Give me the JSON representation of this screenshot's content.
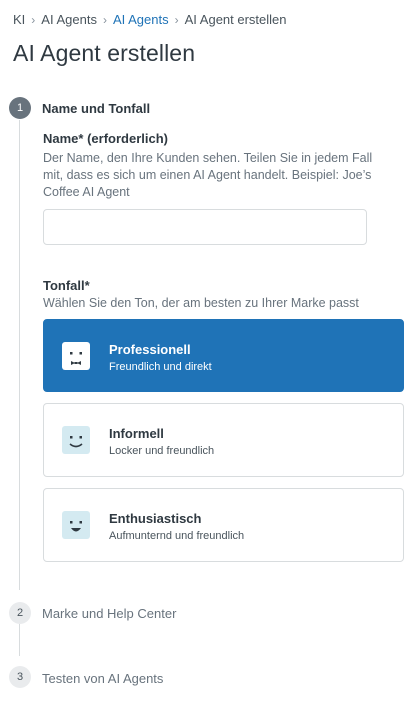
{
  "breadcrumb": {
    "items": [
      "KI",
      "AI Agents",
      "AI Agents",
      "AI Agent erstellen"
    ]
  },
  "page": {
    "title": "AI Agent erstellen"
  },
  "steps": [
    {
      "number": "1",
      "title": "Name und Tonfall",
      "state": "active"
    },
    {
      "number": "2",
      "title": "Marke und Help Center",
      "state": "inactive"
    },
    {
      "number": "3",
      "title": "Testen von AI Agents",
      "state": "inactive"
    }
  ],
  "name_field": {
    "label": "Name* (erforderlich)",
    "help": "Der Name, den Ihre Kunden sehen. Teilen Sie in jedem Fall mit, dass es sich um einen AI Agent handelt. Beispiel: Joe’s Coffee AI Agent",
    "value": "",
    "placeholder": ""
  },
  "tone_field": {
    "label": "Tonfall*",
    "help": "Wählen Sie den Ton, der am besten zu Ihrer Marke passt",
    "options": [
      {
        "title": "Professionell",
        "subtitle": "Freundlich und direkt",
        "icon": "professional-face-icon",
        "selected": true
      },
      {
        "title": "Informell",
        "subtitle": "Locker und freundlich",
        "icon": "smiling-face-icon",
        "selected": false
      },
      {
        "title": "Enthusiastisch",
        "subtitle": "Aufmunternd und freundlich",
        "icon": "grinning-face-icon",
        "selected": false
      }
    ]
  },
  "colors": {
    "accent": "#1f73b7",
    "link": "#1f73b7",
    "face_bg": "#d4eaf1",
    "face_features": "#2f3941"
  }
}
